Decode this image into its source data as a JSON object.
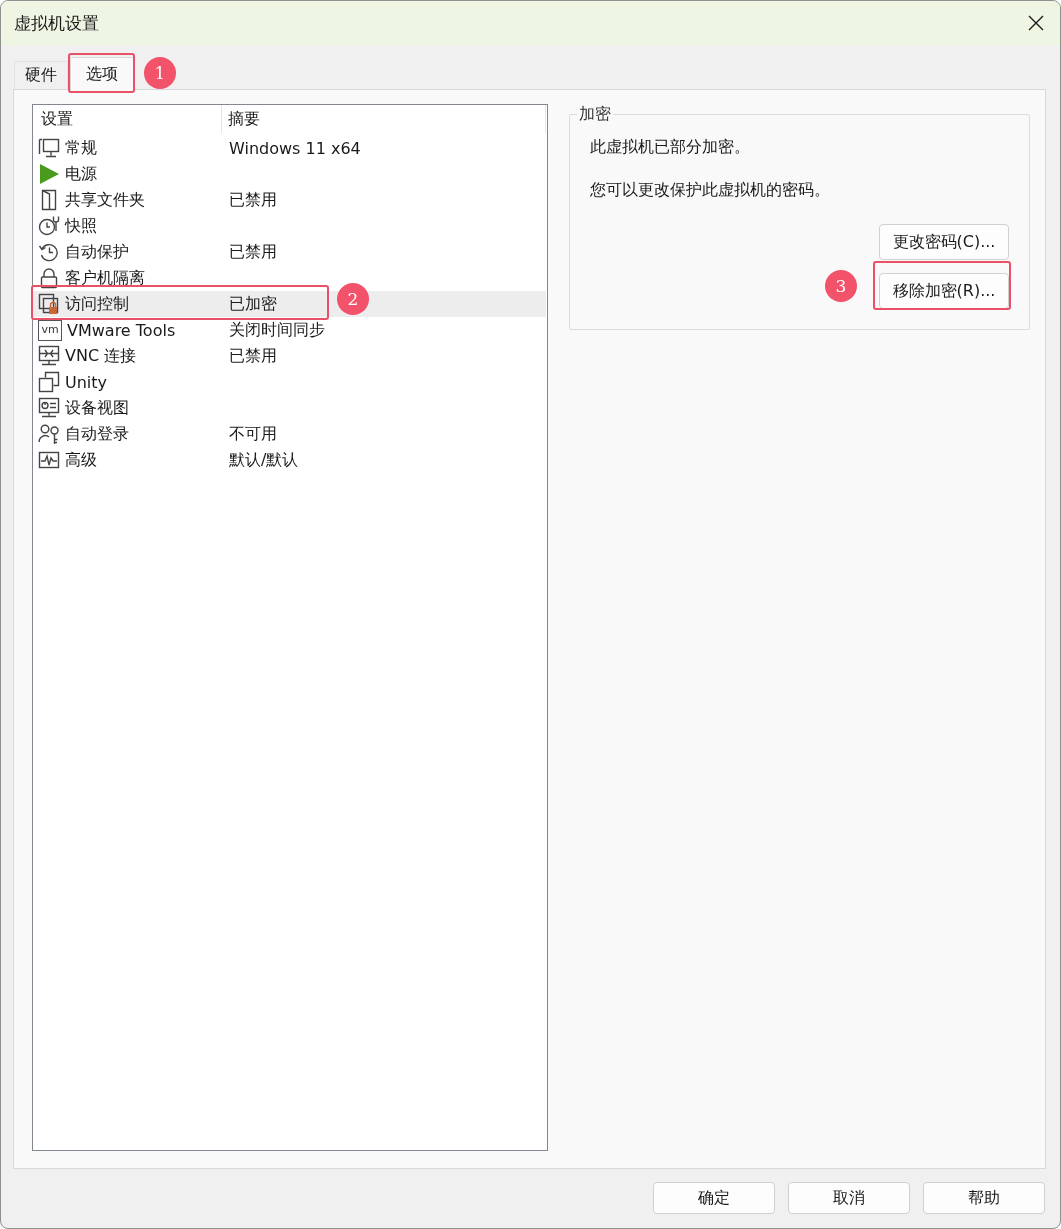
{
  "window": {
    "title": "虚拟机设置"
  },
  "tabs": [
    {
      "label": "硬件",
      "selected": false
    },
    {
      "label": "选项",
      "selected": true,
      "callout": "1"
    }
  ],
  "settings_list": {
    "columns": [
      "设置",
      "摘要"
    ],
    "rows": [
      {
        "name": "常规",
        "summary": "Windows 11 x64",
        "selected": false
      },
      {
        "name": "电源",
        "selected": false
      },
      {
        "name": "共享文件夹",
        "summary": "已禁用",
        "selected": false
      },
      {
        "name": "快照",
        "selected": false
      },
      {
        "name": "自动保护",
        "summary": "已禁用",
        "selected": false
      },
      {
        "name": "客户机隔离",
        "selected": false
      },
      {
        "name": "访问控制",
        "summary": "已加密",
        "selected": true,
        "callout": "2"
      },
      {
        "name": "VMware Tools",
        "summary": "关闭时间同步",
        "selected": false,
        "icon_text": "vm"
      },
      {
        "name": "VNC 连接",
        "summary": "已禁用",
        "selected": false
      },
      {
        "name": "Unity",
        "selected": false
      },
      {
        "name": "设备视图",
        "selected": false
      },
      {
        "name": "自动登录",
        "summary": "不可用",
        "selected": false
      },
      {
        "name": "高级",
        "summary": "默认/默认",
        "selected": false
      }
    ]
  },
  "encryption": {
    "title": "加密",
    "lines": [
      "此虚拟机已部分加密。",
      "您可以更改保护此虚拟机的密码。"
    ],
    "buttons": [
      {
        "label": "更改密码(C)..."
      },
      {
        "label": "移除加密(R)...",
        "callout": "3"
      }
    ]
  },
  "footer_buttons": [
    "确定",
    "取消",
    "帮助"
  ]
}
